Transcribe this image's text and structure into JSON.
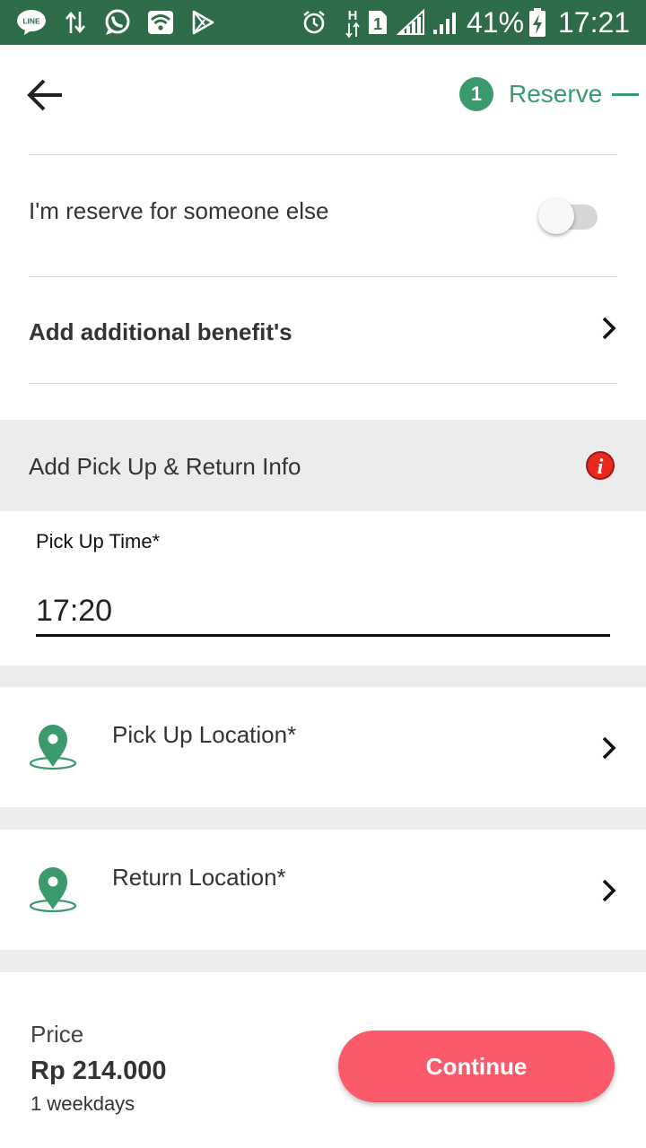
{
  "status_bar": {
    "background": "#2e6b49",
    "icons": [
      "line-app-icon",
      "data-transfer-icon",
      "whatsapp-icon",
      "wifi-icon",
      "play-store-icon",
      "alarm-icon",
      "hspa-icon",
      "sim-1-icon",
      "signal-1-icon",
      "signal-2-icon",
      "battery-icon"
    ],
    "line_label": "LINE",
    "sim_label": "1",
    "hspa_label": "H",
    "battery_percent": "41%",
    "time": "17:21"
  },
  "header": {
    "step_number": "1",
    "step_label": "Reserve",
    "accent_color": "#3a9a6d"
  },
  "reserve_other": {
    "label": "I'm reserve for someone else",
    "toggle_on": false
  },
  "additional_benefit": {
    "label": "Add additional benefit's"
  },
  "pickup_section": {
    "title": "Add Pick Up & Return Info",
    "info_icon_glyph": "i"
  },
  "pickup_time": {
    "label": "Pick Up Time*",
    "value": "17:20"
  },
  "pickup_location": {
    "label": "Pick Up Location*"
  },
  "return_location": {
    "label": "Return Location*"
  },
  "footer": {
    "price_label": "Price",
    "price_value": "Rp 214.000",
    "duration": "1 weekdays",
    "continue_label": "Continue",
    "button_color": "#fb5a6b"
  }
}
